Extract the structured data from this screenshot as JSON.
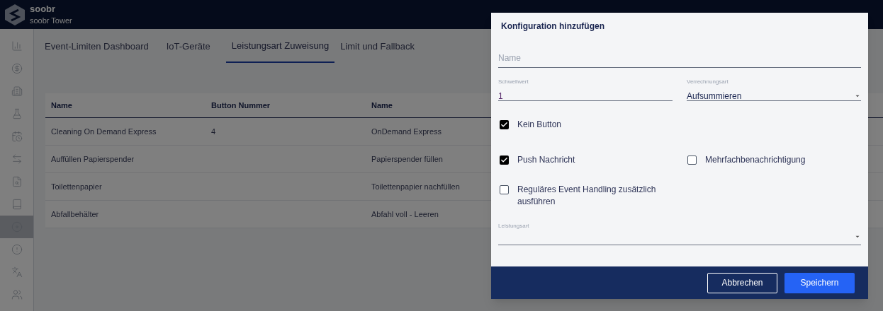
{
  "header": {
    "brand": "soobr",
    "subtitle": "soobr Tower"
  },
  "sidebar": {
    "items": [
      {
        "selected": false
      },
      {
        "selected": false
      },
      {
        "selected": false
      },
      {
        "selected": false
      },
      {
        "selected": false
      },
      {
        "selected": false
      },
      {
        "selected": false
      },
      {
        "selected": false
      },
      {
        "selected": true
      },
      {
        "selected": false
      },
      {
        "selected": false
      },
      {
        "selected": false
      }
    ]
  },
  "tabs": [
    {
      "label": "Event-Limiten Dashboard",
      "selected": false
    },
    {
      "label": "IoT-Geräte",
      "selected": false
    },
    {
      "label": "Leistungsart Zuweisung",
      "selected": true
    },
    {
      "label": "Limit und Fallback",
      "selected": false
    }
  ],
  "table": {
    "columns": [
      "Name",
      "Button Nummer",
      "Name"
    ],
    "rows": [
      [
        "Cleaning On Demand Express",
        "4",
        "OnDemand Express"
      ],
      [
        "Auffüllen Papierspender",
        "",
        "Papierspender füllen"
      ],
      [
        "Toilettenpapier",
        "",
        "Toilettenpapier nachfüllen"
      ],
      [
        "Abfallbehälter",
        "",
        "Abfahl voll - Leeren"
      ]
    ]
  },
  "dialog": {
    "title": "Konfiguration hinzufügen",
    "name_field": {
      "placeholder": "Name"
    },
    "threshold_field": {
      "label": "Schwellwert",
      "value": "1"
    },
    "billing_select": {
      "label": "Verrechnungsart",
      "value": "Aufsummieren"
    },
    "checkboxes": [
      {
        "label": "Kein Button",
        "checked": true
      },
      {
        "label": "Push Nachricht",
        "checked": true
      },
      {
        "label": "Mehrfachbenachrichtigung",
        "checked": false
      },
      {
        "label": "Reguläres Event Handling zusätzlich ausführen",
        "checked": false
      }
    ],
    "service_select": {
      "label": "Leistungsart"
    },
    "buttons": [
      {
        "label": "Abbrechen",
        "kind": "outline"
      },
      {
        "label": "Speichern",
        "kind": "primary"
      }
    ]
  }
}
